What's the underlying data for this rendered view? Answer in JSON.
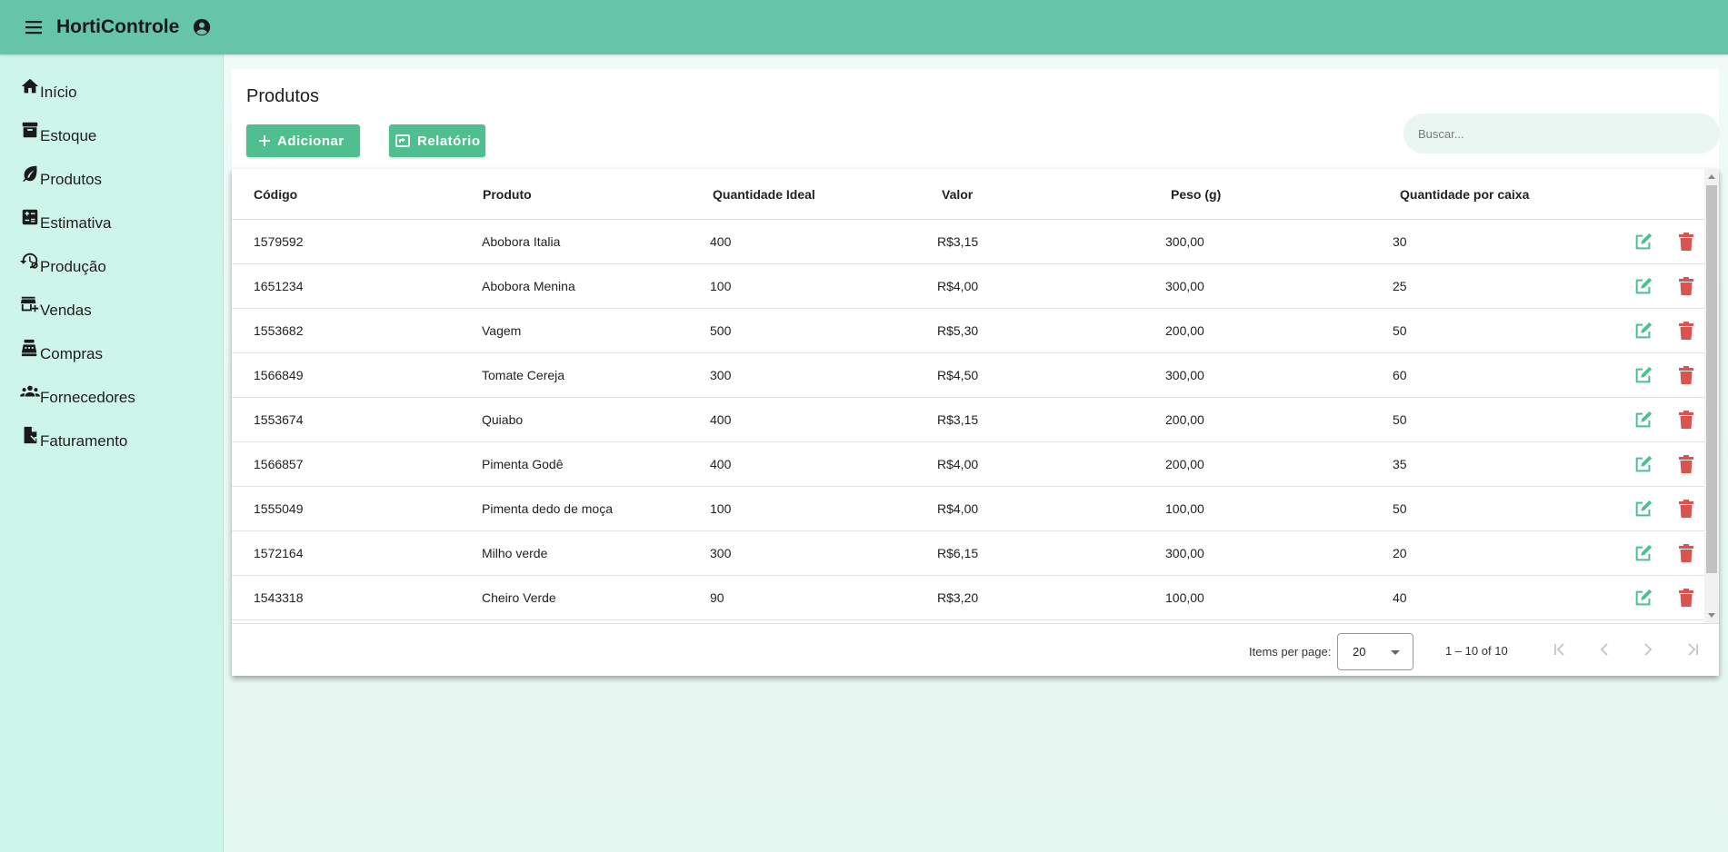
{
  "app": {
    "title": "HortiControle"
  },
  "sidebar": {
    "items": [
      {
        "label": "Início",
        "icon": "home-icon"
      },
      {
        "label": "Estoque",
        "icon": "archive-icon"
      },
      {
        "label": "Produtos",
        "icon": "leaf-icon"
      },
      {
        "label": "Estimativa",
        "icon": "calculate-icon"
      },
      {
        "label": "Produção",
        "icon": "production-history-icon"
      },
      {
        "label": "Vendas",
        "icon": "add-business-icon"
      },
      {
        "label": "Compras",
        "icon": "point-of-sale-icon"
      },
      {
        "label": "Fornecedores",
        "icon": "groups-icon"
      },
      {
        "label": "Faturamento",
        "icon": "request-quote-icon"
      }
    ]
  },
  "page": {
    "title": "Produtos",
    "add_label": "Adicionar",
    "report_label": "Relatório",
    "search_placeholder": "Buscar..."
  },
  "table": {
    "columns": [
      "Código",
      "Produto",
      "Quantidade Ideal",
      "Valor",
      "Peso (g)",
      "Quantidade por caixa"
    ],
    "rows": [
      [
        "1579592",
        "Abobora Italia",
        "400",
        "R$3,15",
        "300,00",
        "30"
      ],
      [
        "1651234",
        "Abobora Menina",
        "100",
        "R$4,00",
        "300,00",
        "25"
      ],
      [
        "1553682",
        "Vagem",
        "500",
        "R$5,30",
        "200,00",
        "50"
      ],
      [
        "1566849",
        "Tomate Cereja",
        "300",
        "R$4,50",
        "300,00",
        "60"
      ],
      [
        "1553674",
        "Quiabo",
        "400",
        "R$3,15",
        "200,00",
        "50"
      ],
      [
        "1566857",
        "Pimenta Godê",
        "400",
        "R$4,00",
        "200,00",
        "35"
      ],
      [
        "1555049",
        "Pimenta dedo de moça",
        "100",
        "R$4,00",
        "100,00",
        "50"
      ],
      [
        "1572164",
        "Milho verde",
        "300",
        "R$6,15",
        "300,00",
        "20"
      ],
      [
        "1543318",
        "Cheiro Verde",
        "90",
        "R$3,20",
        "100,00",
        "40"
      ]
    ]
  },
  "paginator": {
    "items_per_page_label": "Items per page:",
    "items_per_page_value": "20",
    "range_label": "1 – 10 of 10"
  },
  "colors": {
    "topbar": "#66c4a8",
    "sidebar": "#cdf5ea",
    "primary_button": "#4fbf8f",
    "edit_icon": "#4fbf8f",
    "delete_icon": "#d9534f"
  }
}
